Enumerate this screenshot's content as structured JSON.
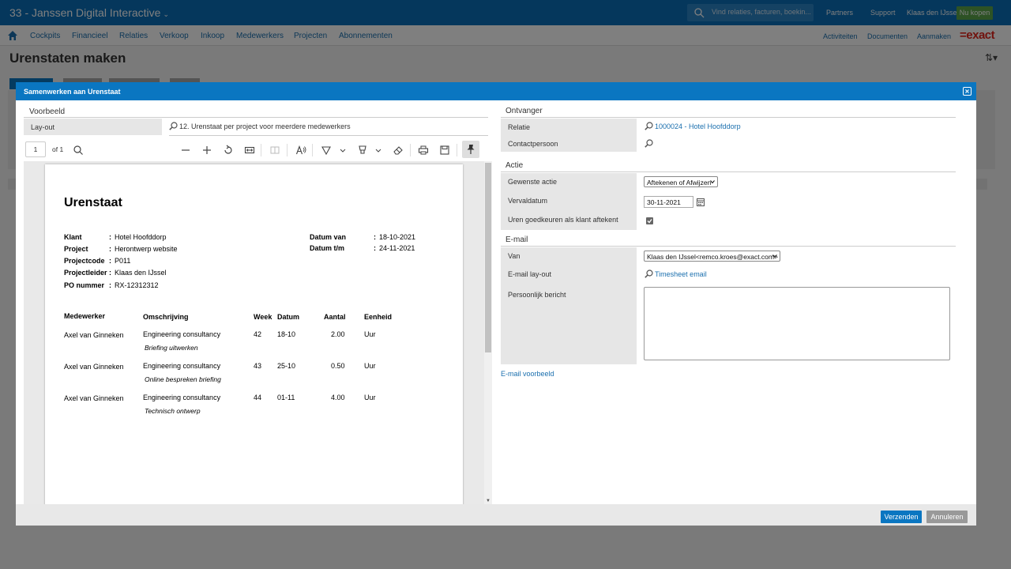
{
  "app": {
    "title": "33 - Janssen Digital Interactive",
    "search_placeholder": "Vind relaties, facturen, boekin...",
    "topnav": [
      "Partners",
      "Support",
      "Klaas den IJssel"
    ],
    "buy_button": "Nu kopen",
    "menu": [
      "Cockpits",
      "Financieel",
      "Relaties",
      "Verkoop",
      "Inkoop",
      "Medewerkers",
      "Projecten",
      "Abonnementen"
    ],
    "menu_right": [
      "Activiteiten",
      "Documenten",
      "Aanmaken"
    ],
    "logo": "=exact",
    "page_title": "Urenstaten maken"
  },
  "modal": {
    "title": "Samenwerken aan Urenstaat",
    "preview": {
      "section": "Voorbeeld",
      "layout_label": "Lay-out",
      "layout_value": "12. Urenstaat per project voor meerdere medewerkers",
      "page_number": "1",
      "page_of": "of 1"
    },
    "recipient": {
      "section": "Ontvanger",
      "relation_label": "Relatie",
      "relation_value": "1000024 - Hotel Hoofddorp",
      "contact_label": "Contactpersoon"
    },
    "action": {
      "section": "Actie",
      "desired_label": "Gewenste actie",
      "desired_value": "Aftekenen of Afwijzen",
      "due_label": "Vervaldatum",
      "due_value": "30-11-2021",
      "approve_label": "Uren goedkeuren als klant aftekent",
      "approve_checked": true
    },
    "email": {
      "section": "E-mail",
      "from_label": "Van",
      "from_value": "Klaas den IJssel<remco.kroes@exact.com>",
      "layout_label": "E-mail lay-out",
      "layout_value": "Timesheet email",
      "message_label": "Persoonlijk bericht",
      "preview_link": "E-mail voorbeeld"
    },
    "buttons": {
      "send": "Verzenden",
      "cancel": "Annuleren"
    }
  },
  "document": {
    "title": "Urenstaat",
    "fields": [
      {
        "key": "Klant",
        "sep": ":",
        "value": "Hotel Hoofddorp"
      },
      {
        "key": "Project",
        "sep": ":",
        "value": "Herontwerp website"
      },
      {
        "key": "Projectcode",
        "sep": ":",
        "value": "P011"
      },
      {
        "key": "Projectleider",
        "sep": ":",
        "value": "Klaas den IJssel"
      },
      {
        "key": "PO nummer",
        "sep": ":",
        "value": "RX-12312312"
      }
    ],
    "dates": [
      {
        "key": "Datum van",
        "sep": ":",
        "value": "18-10-2021"
      },
      {
        "key": "Datum t/m",
        "sep": ":",
        "value": "24-11-2021"
      }
    ],
    "columns": [
      "Medewerker",
      "Omschrijving",
      "Week",
      "Datum",
      "Aantal",
      "Eenheid"
    ],
    "rows": [
      {
        "employee": "Axel van Ginneken",
        "description": "Engineering consultancy",
        "note": "Briefing uitwerken",
        "week": "42",
        "date": "18-10",
        "amount": "2.00",
        "unit": "Uur"
      },
      {
        "employee": "Axel van Ginneken",
        "description": "Engineering consultancy",
        "note": "Online bespreken briefing",
        "week": "43",
        "date": "25-10",
        "amount": "0.50",
        "unit": "Uur"
      },
      {
        "employee": "Axel van Ginneken",
        "description": "Engineering consultancy",
        "note": "Technisch ontwerp",
        "week": "44",
        "date": "01-11",
        "amount": "4.00",
        "unit": "Uur"
      }
    ]
  },
  "colors": {
    "brand_blue": "#0a76c1",
    "exact_red": "#e2261d",
    "link": "#1a6fae",
    "buy_green": "#5aa44a"
  }
}
